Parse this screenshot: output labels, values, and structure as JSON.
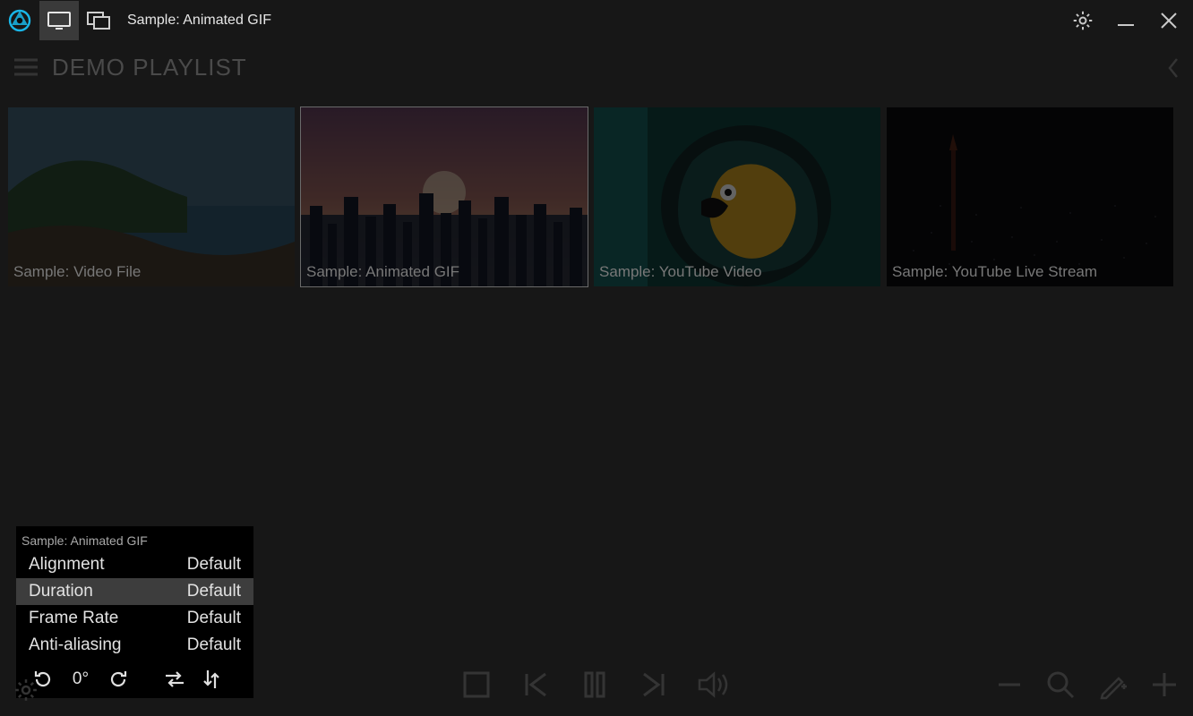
{
  "titlebar": {
    "title": "Sample: Animated GIF"
  },
  "playlist": {
    "name": "DEMO PLAYLIST",
    "items": [
      {
        "label": "Sample: Video File"
      },
      {
        "label": "Sample: Animated GIF"
      },
      {
        "label": "Sample: YouTube Video"
      },
      {
        "label": "Sample: YouTube Live Stream"
      }
    ]
  },
  "popup": {
    "title": "Sample: Animated GIF",
    "rows": [
      {
        "key": "Alignment",
        "value": "Default"
      },
      {
        "key": "Duration",
        "value": "Default"
      },
      {
        "key": "Frame Rate",
        "value": "Default"
      },
      {
        "key": "Anti-aliasing",
        "value": "Default"
      }
    ],
    "rotation": "0°"
  }
}
